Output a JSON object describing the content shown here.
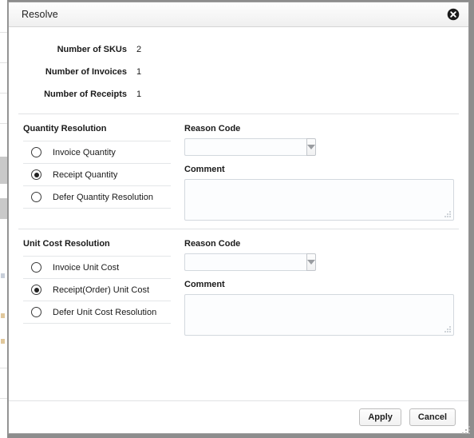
{
  "window": {
    "title": "Resolve",
    "close_icon": "close-circle-icon",
    "resize_grip_icon": "resize-grip-icon"
  },
  "summary": {
    "rows": [
      {
        "label": "Number of SKUs",
        "value": "2"
      },
      {
        "label": "Number of Invoices",
        "value": "1"
      },
      {
        "label": "Number of Receipts",
        "value": "1"
      }
    ]
  },
  "sections": [
    {
      "title": "Quantity Resolution",
      "options": [
        {
          "label": "Invoice Quantity",
          "selected": false
        },
        {
          "label": "Receipt Quantity",
          "selected": true
        },
        {
          "label": "Defer Quantity Resolution",
          "selected": false
        }
      ],
      "reason_code": {
        "label": "Reason Code",
        "value": "",
        "placeholder": "",
        "caret_icon": "chevron-down-icon"
      },
      "comment": {
        "label": "Comment",
        "value": "",
        "placeholder": "",
        "grip_icon": "resize-grip-icon"
      }
    },
    {
      "title": "Unit Cost Resolution",
      "options": [
        {
          "label": "Invoice Unit Cost",
          "selected": false
        },
        {
          "label": "Receipt(Order) Unit Cost",
          "selected": true
        },
        {
          "label": "Defer Unit Cost Resolution",
          "selected": false
        }
      ],
      "reason_code": {
        "label": "Reason Code",
        "value": "",
        "placeholder": "",
        "caret_icon": "chevron-down-icon"
      },
      "comment": {
        "label": "Comment",
        "value": "",
        "placeholder": "",
        "grip_icon": "resize-grip-icon"
      }
    }
  ],
  "footer": {
    "apply_label": "Apply",
    "cancel_label": "Cancel"
  },
  "colors": {
    "dialog_bg": "#ffffff",
    "titlebar_bg": "#f6f6f6",
    "backdrop": "#8d8d8d",
    "divider": "#e0e2e4",
    "field_border": "#d3d8de",
    "text": "#1a1a1a"
  }
}
